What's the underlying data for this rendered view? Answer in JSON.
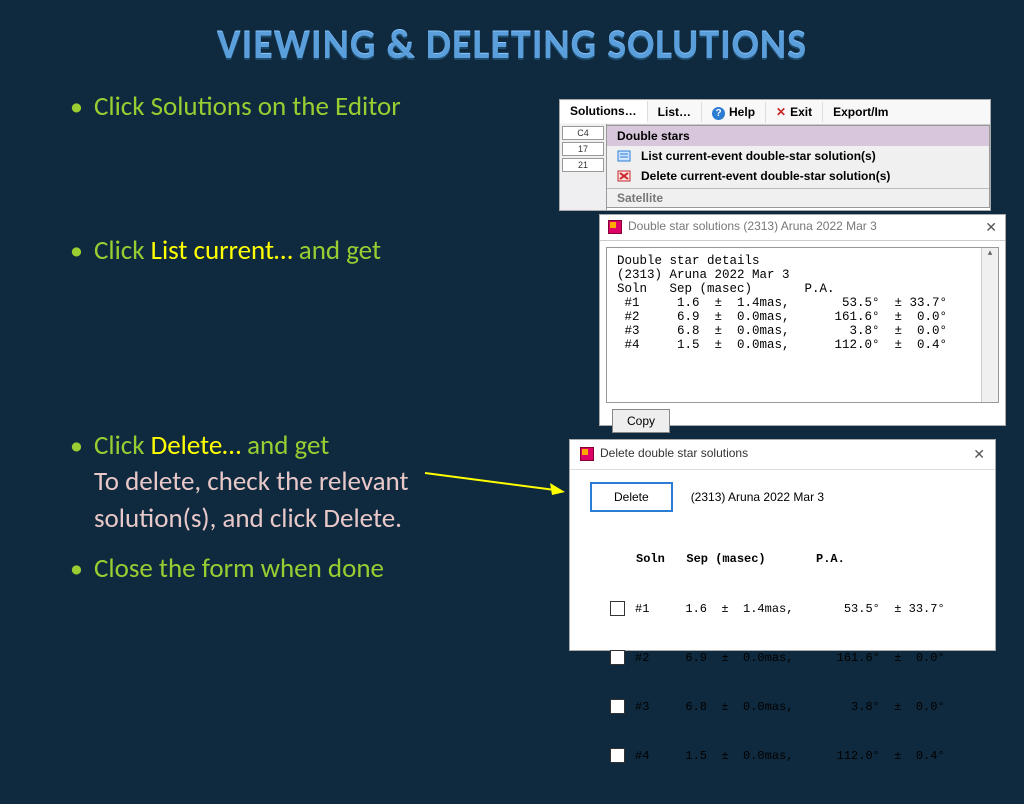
{
  "title": "VIEWING & DELETING SOLUTIONS",
  "bullets": {
    "b1": "Click Solutions on the Editor",
    "b2_a": "Click ",
    "b2_b": "List current…",
    "b2_c": " and get",
    "b3_a": "Click ",
    "b3_b": "Delete…",
    "b3_c": " and get",
    "b3_sub": "To delete, check the relevant solution(s), and click Delete.",
    "b4": "Close the form when done"
  },
  "menu": {
    "solutions": "Solutions…",
    "list": "List…",
    "help": "Help",
    "exit": "Exit",
    "export": "Export/Im",
    "drop_head": "Double stars",
    "drop_item1": "List current-event double-star solution(s)",
    "drop_item2": "Delete current-event double-star solution(s)",
    "drop_sat": "Satellite",
    "side1": "C4",
    "side2": "17",
    "side3": "21"
  },
  "list_window": {
    "title": "Double star solutions (2313) Aruna 2022 Mar 3",
    "body": "Double star details\n(2313) Aruna 2022 Mar 3\nSoln   Sep (masec)       P.A.\n #1     1.6  ±  1.4mas,       53.5°  ± 33.7°\n #2     6.9  ±  0.0mas,      161.6°  ±  0.0°\n #3     6.8  ±  0.0mas,        3.8°  ±  0.0°\n #4     1.5  ±  0.0mas,      112.0°  ±  0.4°",
    "copy": "Copy"
  },
  "delete_window": {
    "title": "Delete double star solutions",
    "delete_btn": "Delete",
    "caption": "(2313) Aruna 2022 Mar 3",
    "header": "Soln   Sep (masec)       P.A.",
    "rows": [
      "#1     1.6  ±  1.4mas,       53.5°  ± 33.7°",
      "#2     6.9  ±  0.0mas,      161.6°  ±  0.0°",
      "#3     6.8  ±  0.0mas,        3.8°  ±  0.0°",
      "#4     1.5  ±  0.0mas,      112.0°  ±  0.4°"
    ]
  },
  "chart_data": {
    "type": "table",
    "title": "Double star solutions — (2313) Aruna 2022 Mar 3",
    "columns": [
      "Soln",
      "Sep (masec)",
      "Sep ± (mas)",
      "P.A. (°)",
      "P.A. ± (°)"
    ],
    "rows": [
      [
        "#1",
        1.6,
        1.4,
        53.5,
        33.7
      ],
      [
        "#2",
        6.9,
        0.0,
        161.6,
        0.0
      ],
      [
        "#3",
        6.8,
        0.0,
        3.8,
        0.0
      ],
      [
        "#4",
        1.5,
        0.0,
        112.0,
        0.4
      ]
    ]
  }
}
